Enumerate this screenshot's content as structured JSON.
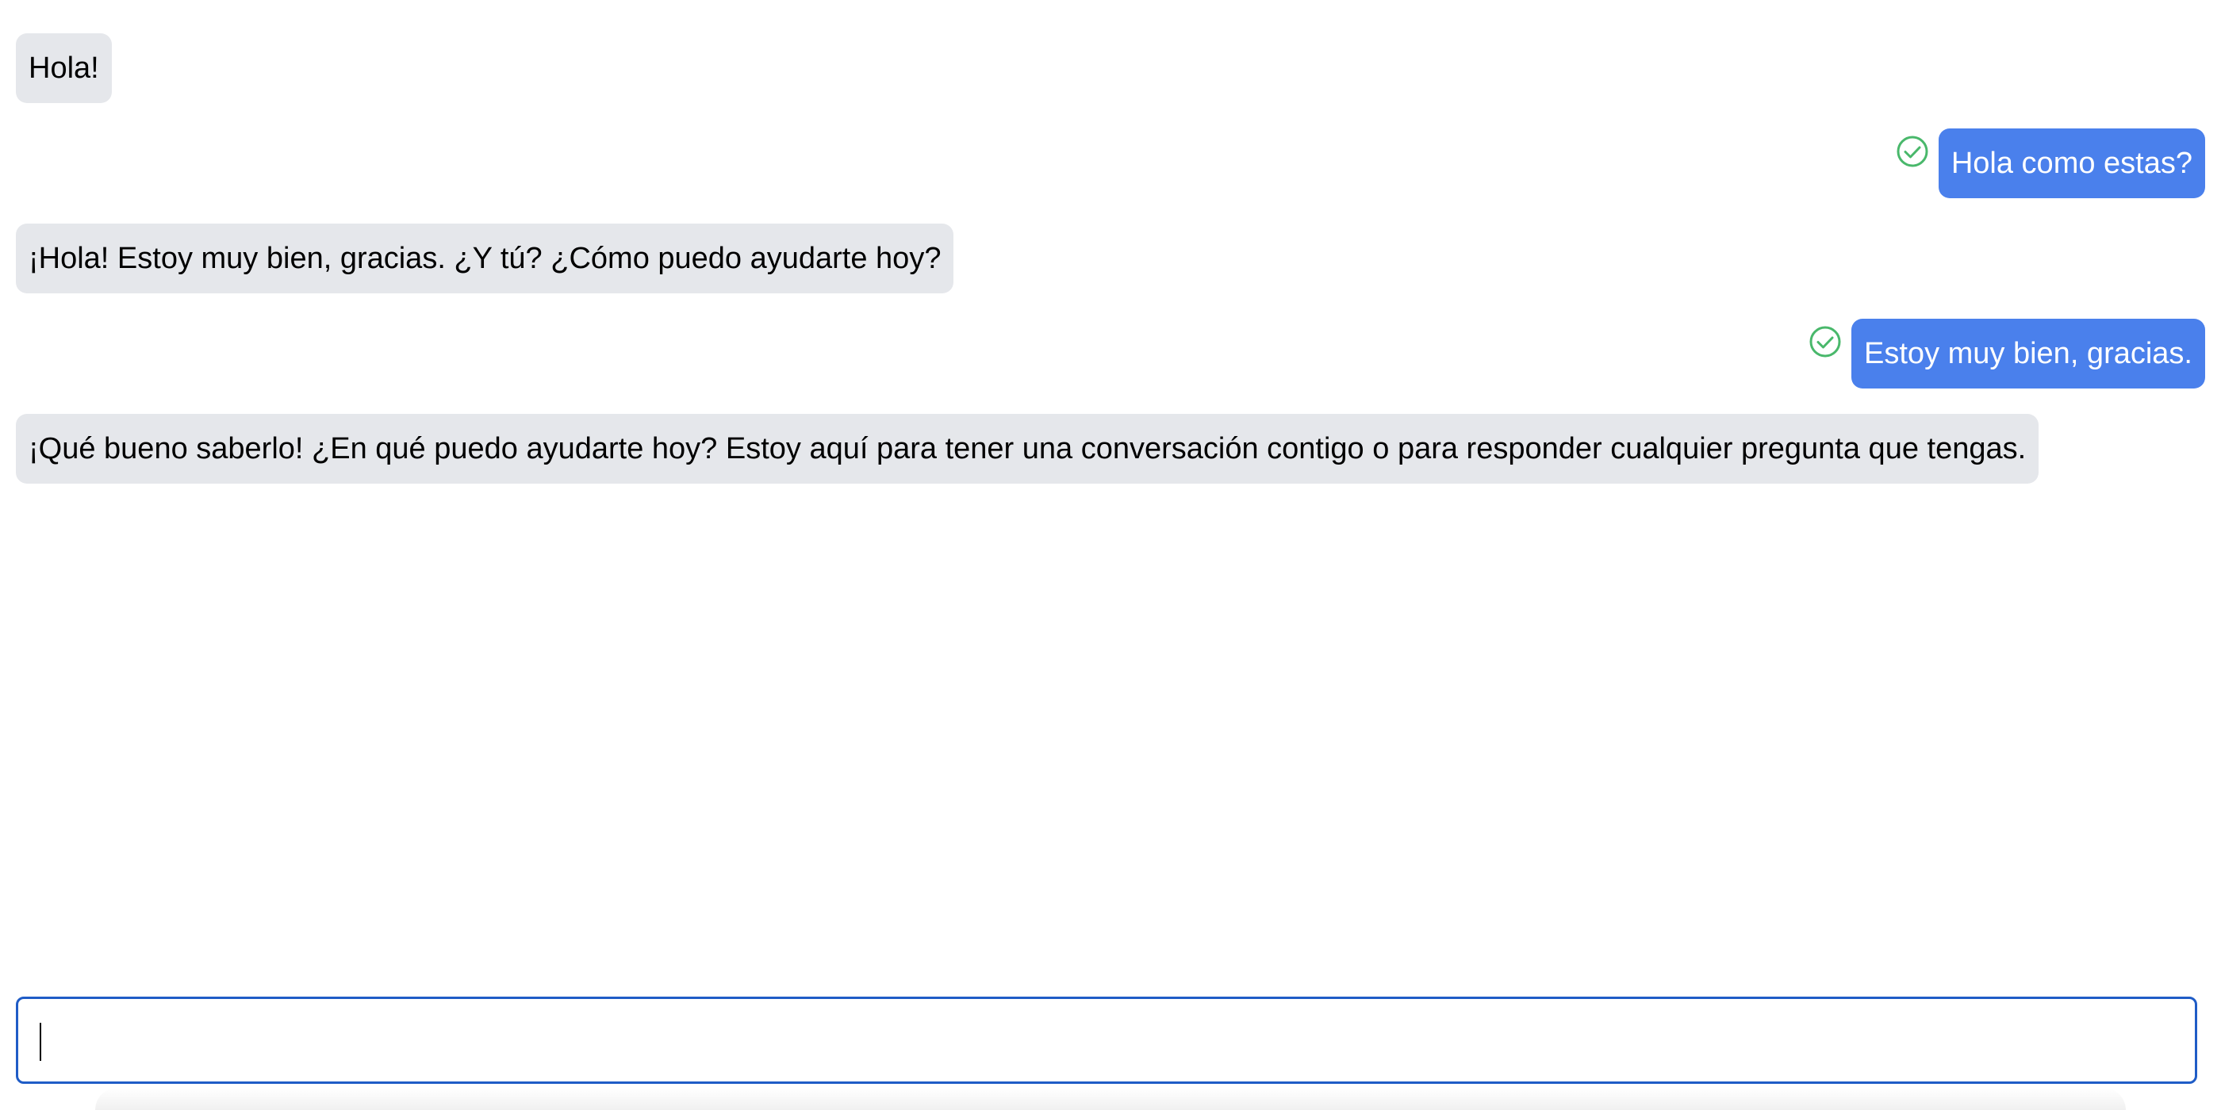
{
  "messages": [
    {
      "role": "incoming",
      "text": "Hola!"
    },
    {
      "role": "outgoing",
      "text": "Hola como estas?",
      "status_icon": "check-circle-icon"
    },
    {
      "role": "incoming",
      "text": "¡Hola! Estoy muy bien, gracias. ¿Y tú? ¿Cómo puedo ayudarte hoy?"
    },
    {
      "role": "outgoing",
      "text": "Estoy muy bien, gracias.",
      "status_icon": "check-circle-icon"
    },
    {
      "role": "incoming",
      "text": "¡Qué bueno saberlo! ¿En qué puedo ayudarte hoy? Estoy aquí para tener una conversación contigo o para responder cualquier pregunta que tengas."
    }
  ],
  "composer": {
    "value": "",
    "placeholder": ""
  },
  "colors": {
    "incoming_bubble": "#e5e7eb",
    "outgoing_bubble": "#4a80ec",
    "sent_check": "#49b86b",
    "composer_border": "#1f5cc6"
  }
}
